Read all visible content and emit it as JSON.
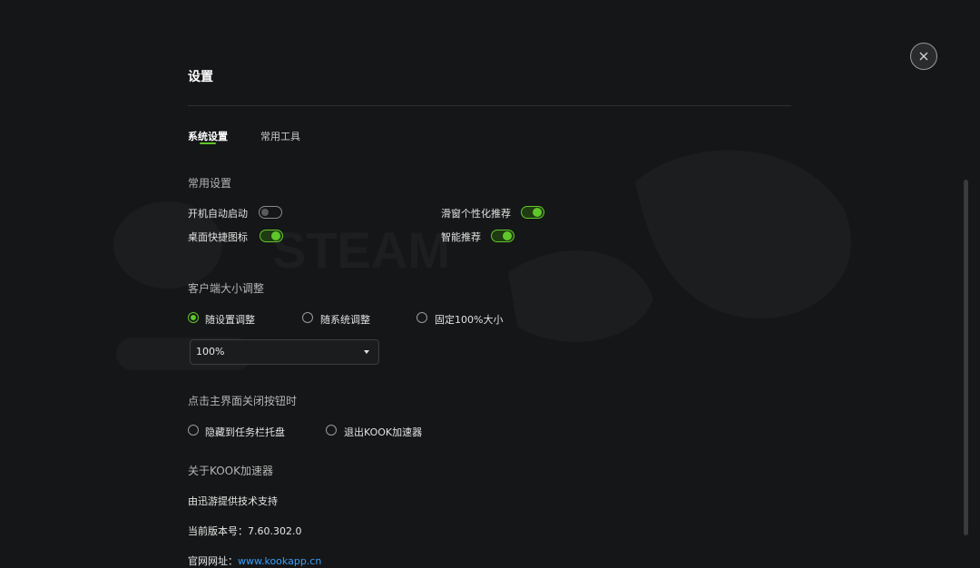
{
  "dialog": {
    "title": "设置",
    "close_icon": "close-icon"
  },
  "tabs": [
    {
      "label": "系统设置",
      "active": true
    },
    {
      "label": "常用工具",
      "active": false
    }
  ],
  "common_settings": {
    "title": "常用设置",
    "options": [
      {
        "label": "开机自动启动",
        "enabled": false
      },
      {
        "label": "滑窗个性化推荐",
        "enabled": true
      },
      {
        "label": "桌面快捷图标",
        "enabled": true
      },
      {
        "label": "智能推荐",
        "enabled": true
      }
    ]
  },
  "client_size": {
    "title": "客户端大小调整",
    "options": [
      {
        "label": "随设置调整",
        "selected": true
      },
      {
        "label": "随系统调整",
        "selected": false
      },
      {
        "label": "固定100%大小",
        "selected": false
      }
    ],
    "select_value": "100%"
  },
  "close_behavior": {
    "title": "点击主界面关闭按钮时",
    "options": [
      {
        "label": "隐藏到任务栏托盘",
        "selected": false
      },
      {
        "label": "退出KOOK加速器",
        "selected": false
      }
    ]
  },
  "about": {
    "title": "关于KOOK加速器",
    "support": "由迅游提供技术支持",
    "version_label": "当前版本号：",
    "version": "7.60.302.0",
    "website_label": "官网网址：",
    "website": "www.kookapp.cn"
  },
  "colors": {
    "accent": "#5fc72a",
    "background": "#151617",
    "link": "#3aa0ff"
  }
}
